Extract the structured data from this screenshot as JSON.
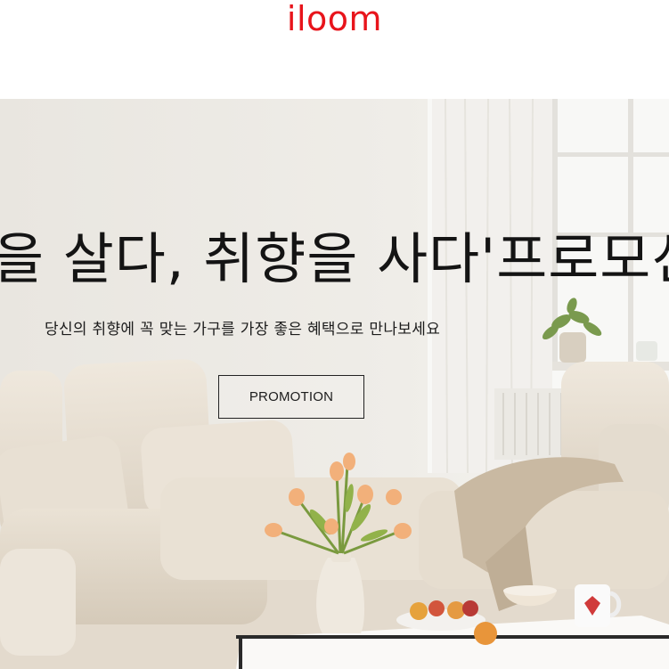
{
  "header": {
    "logo_text": "iloom"
  },
  "hero": {
    "title": "을 살다, 취향을 사다'프로모션",
    "subtitle": "당신의 취향에 꼭 맞는 가구를 가장 좋은 혜택으로 만나보세요",
    "button_label": "PROMOTION"
  },
  "colors": {
    "brand": "#e8141b",
    "text": "#141414",
    "background": "#ffffff"
  }
}
